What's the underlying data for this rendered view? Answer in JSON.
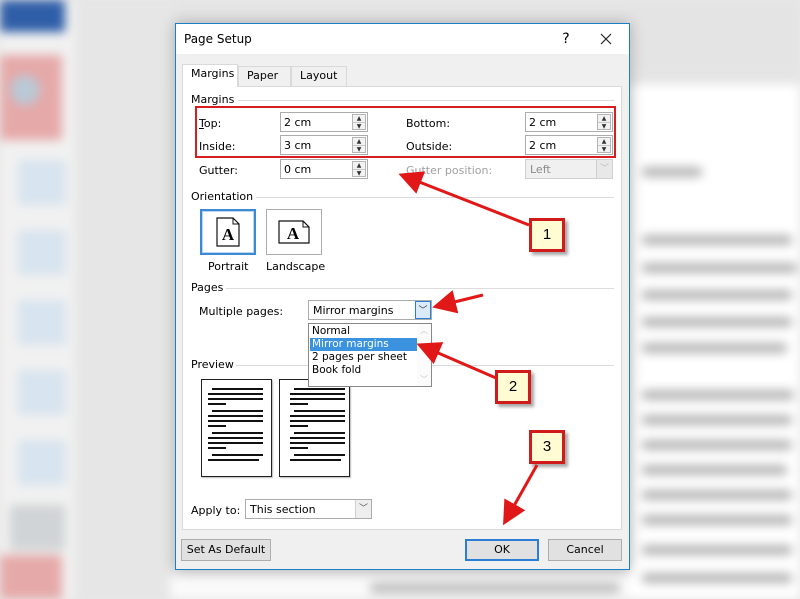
{
  "dialog": {
    "title": "Page Setup",
    "help_label": "?",
    "close_label": "✕",
    "tabs": [
      {
        "label": "Margins",
        "active": true
      },
      {
        "label": "Paper",
        "active": false
      },
      {
        "label": "Layout",
        "active": false
      }
    ]
  },
  "margins": {
    "group_label": "Margins",
    "top": {
      "label": "Top:",
      "value": "2 cm"
    },
    "bottom": {
      "label": "Bottom:",
      "value": "2 cm"
    },
    "inside": {
      "label": "Inside:",
      "value": "3 cm"
    },
    "outside": {
      "label": "Outside:",
      "value": "2 cm"
    },
    "gutter": {
      "label": "Gutter:",
      "value": "0 cm"
    },
    "gutter_position": {
      "label": "Gutter position:",
      "value": "Left",
      "disabled": true
    }
  },
  "orientation": {
    "group_label": "Orientation",
    "portrait": {
      "label": "Portrait",
      "selected": true,
      "glyph": "A"
    },
    "landscape": {
      "label": "Landscape",
      "selected": false,
      "glyph": "A"
    }
  },
  "pages": {
    "group_label": "Pages",
    "multiple_pages_label": "Multiple pages:",
    "multiple_pages_value": "Mirror margins",
    "options": [
      "Normal",
      "Mirror margins",
      "2 pages per sheet",
      "Book fold"
    ],
    "selected_option": "Mirror margins"
  },
  "preview": {
    "group_label": "Preview",
    "apply_to_label": "Apply to:",
    "apply_to_value": "This section"
  },
  "buttons": {
    "set_default": "Set As Default",
    "ok": "OK",
    "cancel": "Cancel"
  },
  "annotations": {
    "callout_1": "1",
    "callout_2": "2",
    "callout_3": "3",
    "highlight_color": "#d41f1f",
    "callout_fill": "#fffbd2"
  },
  "colors": {
    "accent": "#2a7fd4",
    "selection": "#3b93e0",
    "dialog_bg": "#f0f0f0"
  }
}
